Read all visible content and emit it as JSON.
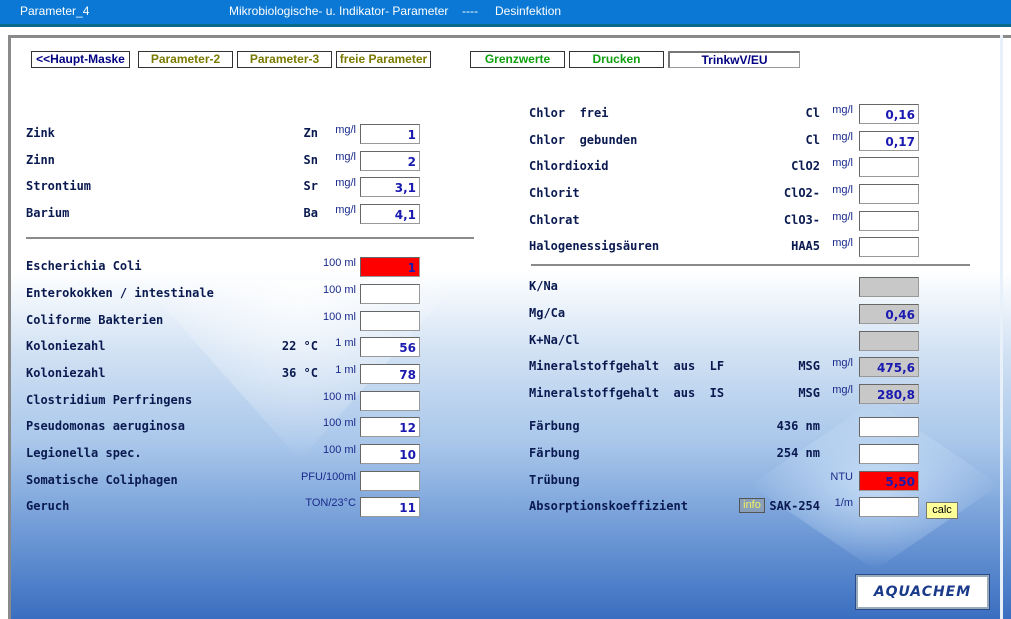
{
  "title": {
    "form": "Parameter_4",
    "subtitle": "Mikrobiologische- u. Indikator- Parameter",
    "sep": "----",
    "section": "Desinfektion"
  },
  "nav": [
    {
      "label": "<<Haupt-Maske",
      "color": "#000080",
      "name": "haupt-maske-button"
    },
    {
      "label": "Parameter-2",
      "color": "#7a7a00",
      "name": "parameter-2-button"
    },
    {
      "label": "Parameter-3",
      "color": "#7a7a00",
      "name": "parameter-3-button"
    },
    {
      "label": "freie Parameter",
      "color": "#7a7a00",
      "name": "freie-parameter-button"
    },
    {
      "label": "Grenzwerte",
      "color": "#10a010",
      "name": "grenzwerte-button"
    },
    {
      "label": "Drucken",
      "color": "#10a010",
      "name": "drucken-button"
    },
    {
      "label": "TrinkwV/EU",
      "color": "#000080",
      "name": "trinkwv-eu-button"
    }
  ],
  "left_top": [
    {
      "label": "Zink",
      "sym": "Zn",
      "unit": "mg/l",
      "value": "1"
    },
    {
      "label": "Zinn",
      "sym": "Sn",
      "unit": "mg/l",
      "value": "2"
    },
    {
      "label": "Strontium",
      "sym": "Sr",
      "unit": "mg/l",
      "value": "3,1"
    },
    {
      "label": "Barium",
      "sym": "Ba",
      "unit": "mg/l",
      "value": "4,1"
    }
  ],
  "left_bottom": [
    {
      "label": "Escherichia Coli",
      "sym": "",
      "unit": "100 ml",
      "value": "1",
      "state": "red"
    },
    {
      "label": "Enterokokken / intestinale",
      "sym": "",
      "unit": "100 ml",
      "value": ""
    },
    {
      "label": "Coliforme Bakterien",
      "sym": "",
      "unit": "100 ml",
      "value": ""
    },
    {
      "label": "Koloniezahl",
      "sym": "22 °C",
      "unit": "1 ml",
      "value": "56"
    },
    {
      "label": "Koloniezahl",
      "sym": "36 °C",
      "unit": "1 ml",
      "value": "78"
    },
    {
      "label": "Clostridium Perfringens",
      "sym": "",
      "unit": "100 ml",
      "value": ""
    },
    {
      "label": "Pseudomonas aeruginosa",
      "sym": "",
      "unit": "100 ml",
      "value": "12"
    },
    {
      "label": "Legionella spec.",
      "sym": "",
      "unit": "100 ml",
      "value": "10"
    },
    {
      "label": "Somatische Coliphagen",
      "sym": "",
      "unit": "PFU/100ml",
      "value": ""
    },
    {
      "label": "Geruch",
      "sym": "",
      "unit": "TON/23°C",
      "value": "11"
    }
  ],
  "right_top": [
    {
      "label": "Chlor  frei",
      "sym": "Cl",
      "unit": "mg/l",
      "value": "0,16"
    },
    {
      "label": "Chlor  gebunden",
      "sym": "Cl",
      "unit": "mg/l",
      "value": "0,17"
    },
    {
      "label": "Chlordioxid",
      "sym": "ClO2",
      "unit": "mg/l",
      "value": ""
    },
    {
      "label": "Chlorit",
      "sym": "ClO2-",
      "unit": "mg/l",
      "value": ""
    },
    {
      "label": "Chlorat",
      "sym": "ClO3-",
      "unit": "mg/l",
      "value": ""
    },
    {
      "label": "Halogenessigsäuren",
      "sym": "HAA5",
      "unit": "mg/l",
      "value": ""
    }
  ],
  "right_bottom": [
    {
      "label": "K/Na",
      "sym": "",
      "unit": "",
      "value": "",
      "state": "gray"
    },
    {
      "label": "Mg/Ca",
      "sym": "",
      "unit": "",
      "value": "0,46",
      "state": "gray"
    },
    {
      "label": "K+Na/Cl",
      "sym": "",
      "unit": "",
      "value": "",
      "state": "gray"
    },
    {
      "label": "Mineralstoffgehalt  aus  LF",
      "sym": "MSG",
      "unit": "mg/l",
      "value": "475,6",
      "state": "gray"
    },
    {
      "label": "Mineralstoffgehalt  aus  IS",
      "sym": "MSG",
      "unit": "mg/l",
      "value": "280,8",
      "state": "gray"
    },
    {
      "label": "Färbung",
      "sym": "436 nm",
      "unit": "",
      "value": ""
    },
    {
      "label": "Färbung",
      "sym": "254 nm",
      "unit": "",
      "value": ""
    },
    {
      "label": "Trübung",
      "sym": "",
      "unit": "NTU",
      "value": "5,50",
      "state": "red"
    },
    {
      "label": "Absorptionskoeffizient",
      "sym": "SAK-254",
      "unit": "1/m",
      "value": ""
    }
  ],
  "buttons": {
    "info": "info",
    "calc": "calc"
  },
  "logo": "AQUACHEM"
}
